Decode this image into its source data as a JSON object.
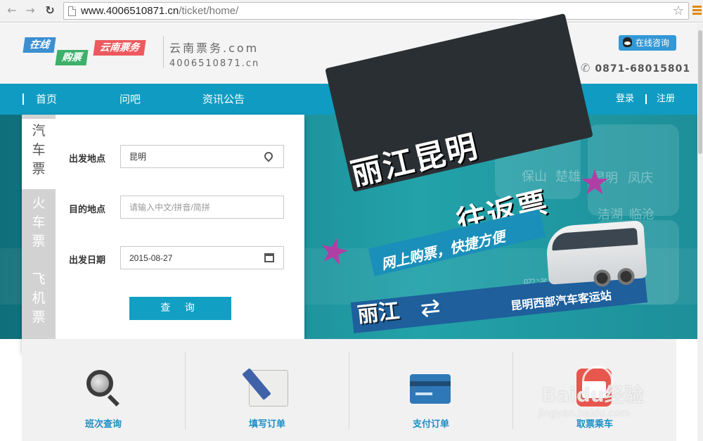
{
  "browser": {
    "url_host": "www.4006510871.cn",
    "url_path": "/ticket/home/"
  },
  "header": {
    "logo_tags": [
      "在线",
      "购票",
      "云南票务"
    ],
    "site_name": "云南票务.com",
    "site_phone": "4006510871.cn",
    "consult_label": "在线咨询",
    "hotline": "0871-68015801"
  },
  "nav": {
    "items": [
      "首页",
      "问吧",
      "资讯公告"
    ],
    "login": "登录",
    "register": "注册"
  },
  "banner": {
    "headline_1": "丽江昆明",
    "headline_2": "往返票",
    "slogan": "网上购票，快捷方便",
    "route_from": "丽江",
    "route_to": "昆明西部汽车客运站",
    "ghost_cities": [
      "保山",
      "楚雄",
      "昆明",
      "凤庆",
      "洁湖",
      "临沧",
      "昭通"
    ]
  },
  "search_panel": {
    "tabs": [
      {
        "chars": [
          "汽",
          "车",
          "票"
        ]
      },
      {
        "chars": [
          "火",
          "车",
          "票"
        ]
      },
      {
        "chars": [
          "飞",
          "机",
          "票"
        ]
      }
    ],
    "from_label": "出发地点",
    "from_value": "昆明",
    "to_label": "目的地点",
    "to_placeholder": "请输入中文/拼音/简拼",
    "date_label": "出发日期",
    "date_value": "2015-08-27",
    "search_button": "查 询"
  },
  "features": [
    {
      "label": "班次查询",
      "icon": "magnifier-icon"
    },
    {
      "label": "填写订单",
      "icon": "edit-order-icon"
    },
    {
      "label": "支付订单",
      "icon": "credit-card-icon"
    },
    {
      "label": "取票乘车",
      "icon": "ticket-icon"
    }
  ],
  "watermark": {
    "main": "Baidu经验",
    "sub": "jingyan.baidu.com"
  }
}
